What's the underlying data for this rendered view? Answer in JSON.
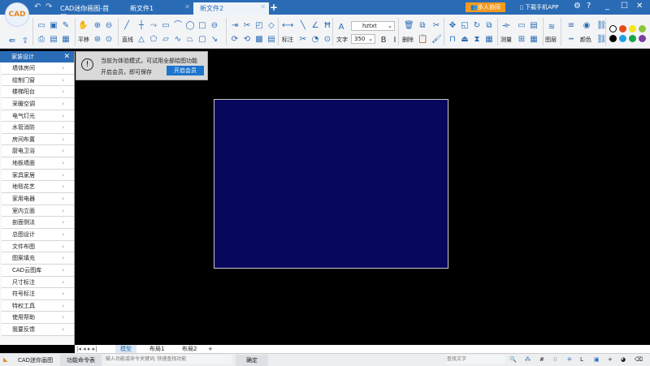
{
  "titlebar": {
    "logo": "CAD",
    "tabs": [
      {
        "label": "CAD迷你画图-首页"
      },
      {
        "label": "新文件1"
      },
      {
        "label": "新文件2",
        "active": true
      }
    ],
    "collab": "多人协同",
    "download_app": "下载手机APP"
  },
  "toolbar": {
    "labels": {
      "pan": "平移",
      "line": "直线",
      "dim": "标注",
      "text": "文字",
      "delete": "删除",
      "measure": "测量",
      "layer": "图层",
      "color": "颜色"
    },
    "font": "hztxt",
    "font_size": "350",
    "bold": "B",
    "italic": "I",
    "swatches": [
      "#ffffff",
      "#e84a1a",
      "#f5e61a",
      "#8cc63f",
      "#000000",
      "#1ea0e6",
      "#1aa34a",
      "#7a3fa0"
    ]
  },
  "sidebar": {
    "header": "家装设计",
    "items": [
      "墙体房间",
      "绘制门窗",
      "楼梯阳台",
      "采暖空调",
      "电气灯光",
      "水管消防",
      "房间布置",
      "厨电卫浴",
      "地板墙面",
      "家具家居",
      "地毯花艺",
      "家用电器",
      "室内立面",
      "剖面侧法",
      "总图设计",
      "文件布图",
      "图案填充",
      "CAD云图库",
      "尺寸标注",
      "符号标注",
      "特权工具",
      "使用帮助",
      "我要反馈"
    ]
  },
  "notice": {
    "line1": "当前为体验模式，可试用全部绘图功能",
    "line2": "开启会员，即可保存",
    "button": "开启会员"
  },
  "layout_tabs": [
    "模型",
    "布局1",
    "布局2"
  ],
  "statusbar": {
    "app": "CAD迷你画图",
    "commands": "功能命令表",
    "command_placeholder": "输入功能或命令关键词, 快速查找功能",
    "confirm": "确定",
    "search_placeholder": "查找文字"
  },
  "colors": {
    "accent": "#2a6bb5",
    "drawing_fill": "#07075c",
    "canvas": "#000000"
  }
}
